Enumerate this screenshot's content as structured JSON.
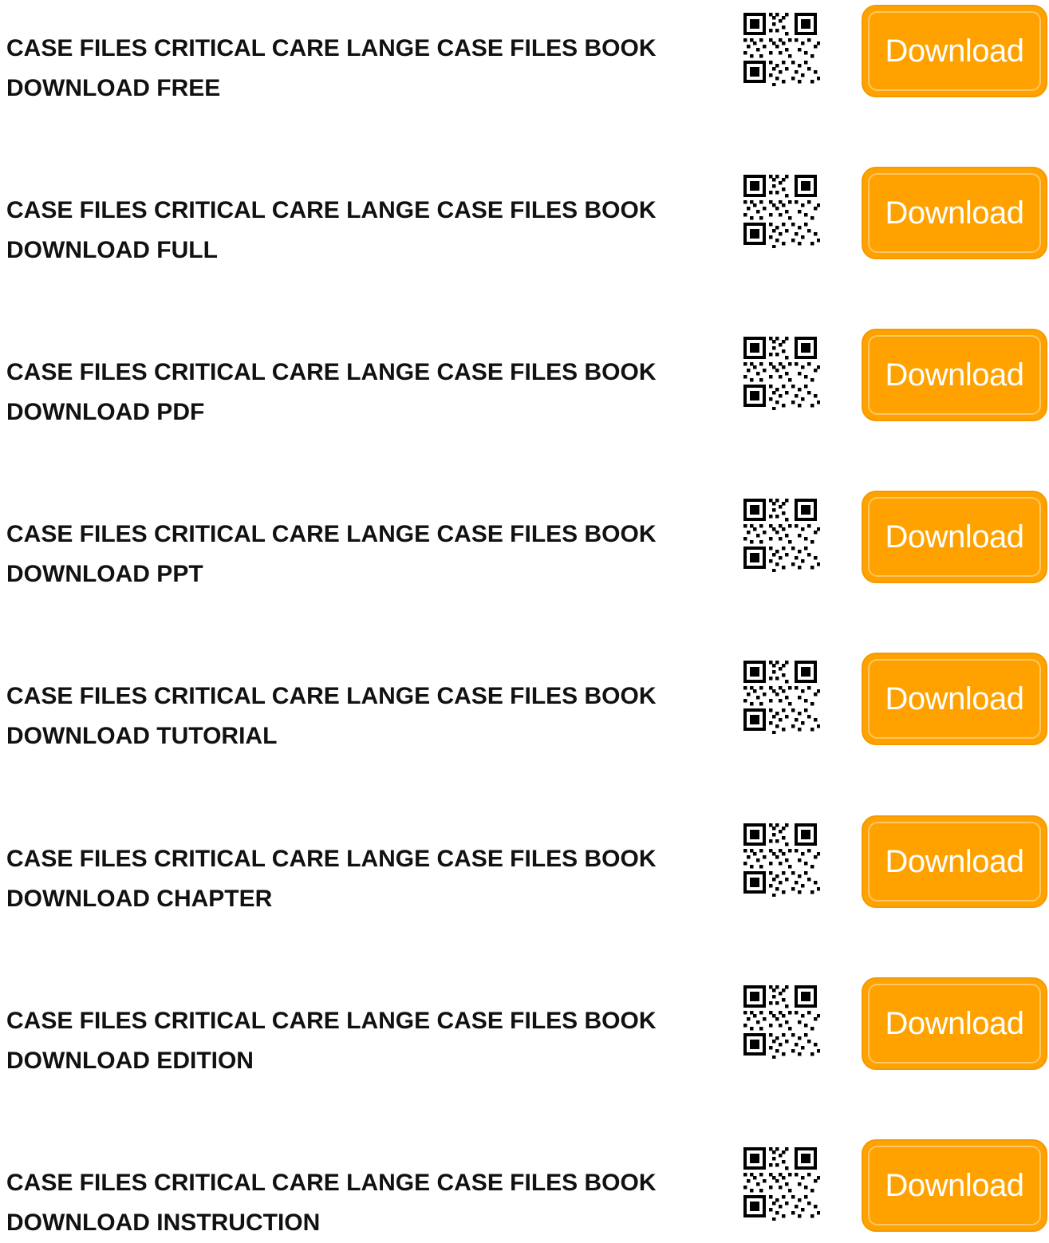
{
  "colors": {
    "button_bg": "#ffa200",
    "button_text": "#ffffff",
    "title_text": "#111111"
  },
  "items": [
    {
      "title_line1": "CASE FILES CRITICAL CARE LANGE CASE FILES BOOK",
      "title_line2": "DOWNLOAD FREE",
      "button_label": "Download",
      "qr_icon": "qr-code-icon"
    },
    {
      "title_line1": "CASE FILES CRITICAL CARE LANGE CASE FILES BOOK",
      "title_line2": "DOWNLOAD FULL",
      "button_label": "Download",
      "qr_icon": "qr-code-icon"
    },
    {
      "title_line1": "CASE FILES CRITICAL CARE LANGE CASE FILES BOOK",
      "title_line2": "DOWNLOAD PDF",
      "button_label": "Download",
      "qr_icon": "qr-code-icon"
    },
    {
      "title_line1": "CASE FILES CRITICAL CARE LANGE CASE FILES BOOK",
      "title_line2": "DOWNLOAD PPT",
      "button_label": "Download",
      "qr_icon": "qr-code-icon"
    },
    {
      "title_line1": "CASE FILES CRITICAL CARE LANGE CASE FILES BOOK",
      "title_line2": "DOWNLOAD TUTORIAL",
      "button_label": "Download",
      "qr_icon": "qr-code-icon"
    },
    {
      "title_line1": "CASE FILES CRITICAL CARE LANGE CASE FILES BOOK",
      "title_line2": "DOWNLOAD CHAPTER",
      "button_label": "Download",
      "qr_icon": "qr-code-icon"
    },
    {
      "title_line1": "CASE FILES CRITICAL CARE LANGE CASE FILES BOOK",
      "title_line2": "DOWNLOAD EDITION",
      "button_label": "Download",
      "qr_icon": "qr-code-icon"
    },
    {
      "title_line1": "CASE FILES CRITICAL CARE LANGE CASE FILES BOOK",
      "title_line2": "DOWNLOAD INSTRUCTION",
      "button_label": "Download",
      "qr_icon": "qr-code-icon"
    }
  ]
}
